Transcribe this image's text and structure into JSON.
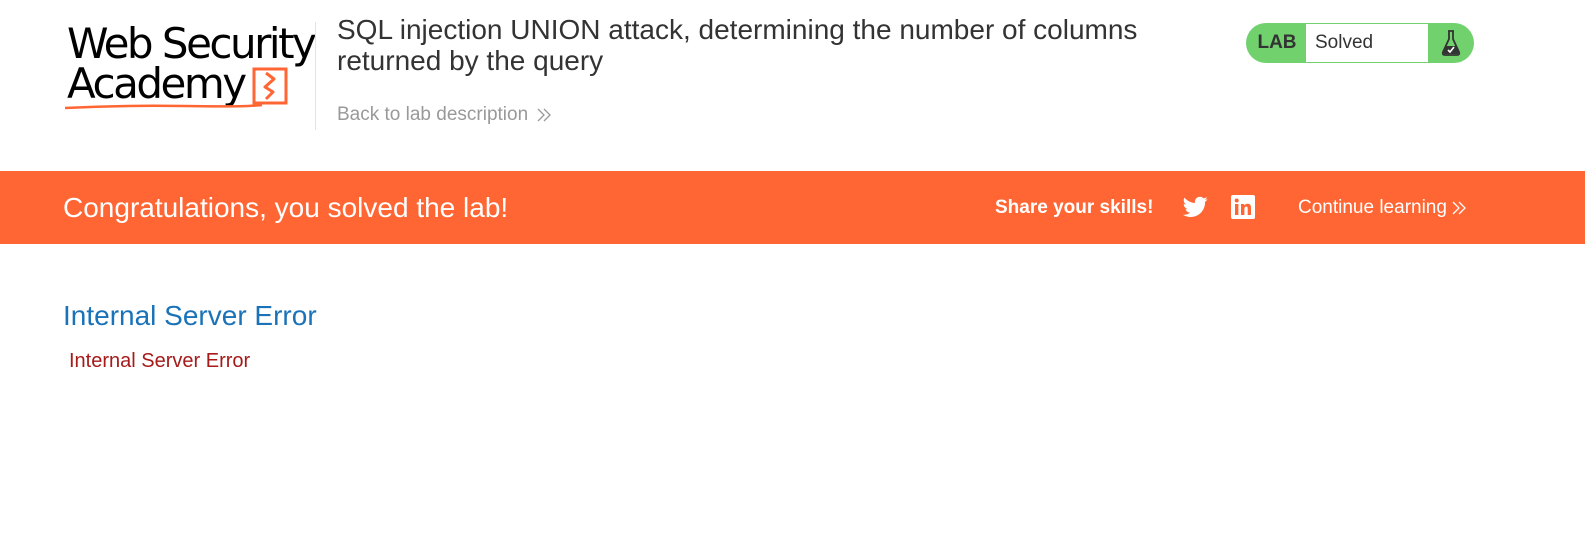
{
  "header": {
    "logo": {
      "line1": "Web Security",
      "line2": "Academy"
    },
    "lab_title": "SQL injection UNION attack, determining the number of columns returned by the query",
    "back_link": "Back to lab description",
    "status": {
      "tag": "LAB",
      "value": "Solved",
      "icon": "flask-icon"
    }
  },
  "banner": {
    "message": "Congratulations, you solved the lab!",
    "share_label": "Share your skills!",
    "social_icons": [
      "twitter-icon",
      "linkedin-icon"
    ],
    "continue_link": "Continue learning"
  },
  "content": {
    "heading": "Internal Server Error",
    "message": "Internal Server Error"
  },
  "colors": {
    "accent": "#ff6633",
    "status_green": "#70d16d",
    "heading_blue": "#1a72b8",
    "error_red": "#a61a1a",
    "muted_text": "#999999",
    "body_text": "#333333"
  }
}
